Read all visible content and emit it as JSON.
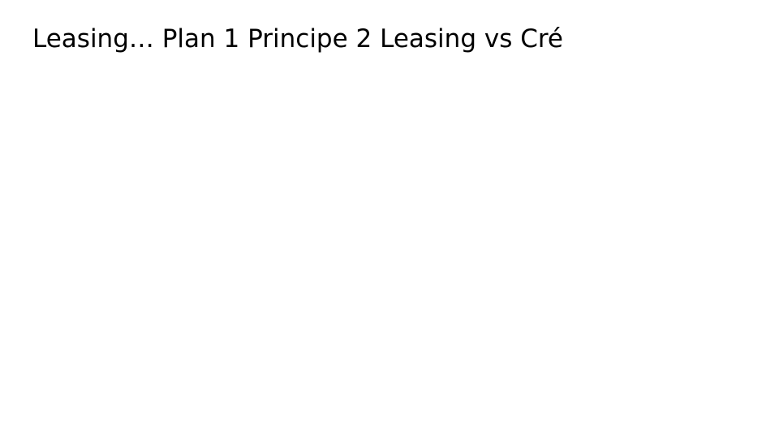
{
  "slide": {
    "title": "Leasing… Plan 1 Principe 2 Leasing vs Cré"
  }
}
